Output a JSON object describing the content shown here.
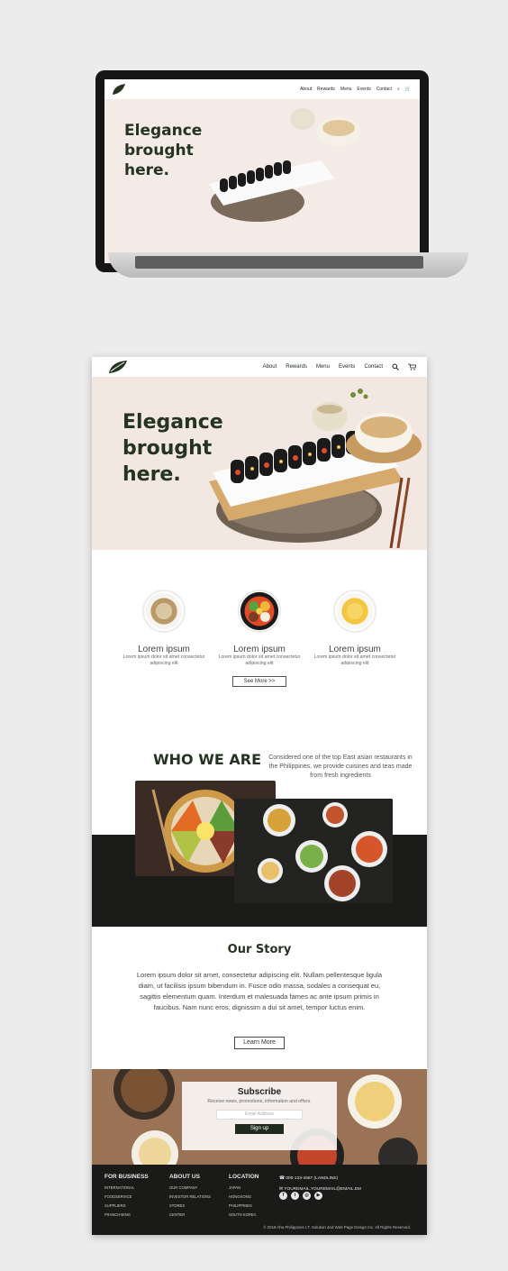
{
  "laptop": {
    "nav": {
      "items": [
        "About",
        "Rewards",
        "Menu",
        "Events",
        "Contact"
      ]
    },
    "hero_title": "Elegance brought here."
  },
  "nav": {
    "items": [
      "About",
      "Rewards",
      "Menu",
      "Events",
      "Contact"
    ]
  },
  "hero": {
    "title": "Elegance brought here."
  },
  "features": [
    {
      "title": "Lorem ipsum",
      "text": "Lorem ipsum dolor sit amet consectetur adipiscing elit"
    },
    {
      "title": "Lorem ipsum",
      "text": "Lorem ipsum dolor sit amet consectetur adipiscing elit"
    },
    {
      "title": "Lorem ipsum",
      "text": "Lorem ipsum dolor sit amet consectetur adipiscing elit"
    }
  ],
  "see_more": "See More >>",
  "who": {
    "title": "WHO WE ARE",
    "text": "Considered one of the top East asian restaurants in the Philippines, we provide cuisines and teas made from fresh ingredients"
  },
  "story": {
    "title": "Our Story",
    "text": "Lorem ipsum dolor sit amet, consectetur adipiscing elit. Nullam pellentesque ligula diam, ut facilisis ipsum bibendum in. Fusce odio massa, sodales a consequat eu, sagittis elementum quam. Interdum et malesuada fames ac ante ipsum primis in faucibus. Nam nunc eros, dignissim a dui sit amet, tempor luctus enim.",
    "button": "Learn More"
  },
  "subscribe": {
    "title": "Subscribe",
    "text": "Receive news, promotions, information and offers.",
    "email_placeholder": "Email Address",
    "button": "Sign up"
  },
  "footer": {
    "business": {
      "title": "FOR BUSINESS",
      "items": [
        "INTERNATIONAL",
        "FOODSERVICE",
        "SUPPLIERS",
        "FRANCHISING"
      ]
    },
    "about": {
      "title": "ABOUT US",
      "items": [
        "OUR COMPANY",
        "INVESTOR RELATIONS",
        "STORES",
        "CENTER"
      ]
    },
    "location": {
      "title": "LOCATION",
      "items": [
        "JAPAN",
        "HONGKONG",
        "PHILIPPINES",
        "SOUTH KOREA"
      ]
    },
    "phone": "000-123-4567 (LANDLINE)",
    "email": "YOUREMAIL.YOUREMAIL@EMAIL.EM",
    "copyright": "© 2018 Aha Philippines I.T. Solution and Web Page Design Inc. All Rights Reserved."
  },
  "colors": {
    "brand_dark": "#243421",
    "hero_bg": "#f2e7e1",
    "footer_bg": "#1a1b19"
  },
  "icons": [
    "leaf-logo-icon",
    "search-icon",
    "cart-icon",
    "phone-icon",
    "mail-icon",
    "facebook-icon",
    "twitter-icon",
    "instagram-icon",
    "youtube-icon"
  ]
}
